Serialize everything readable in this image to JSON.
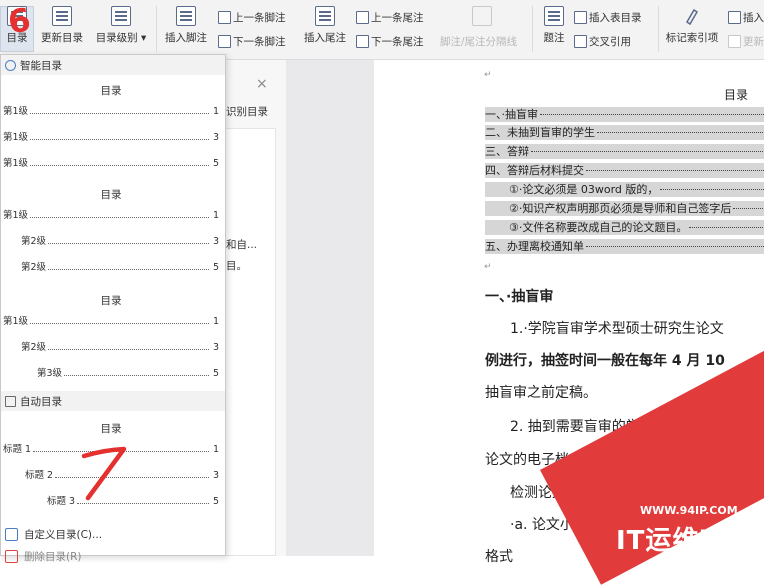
{
  "ribbon": {
    "toc_label": "目录",
    "update_toc": "更新目录",
    "toc_level": "目录级别",
    "insert_footnote": "插入脚注",
    "prev_footnote": "上一条脚注",
    "next_footnote": "下一条脚注",
    "insert_endnote": "插入尾注",
    "prev_endnote": "上一条尾注",
    "next_endnote": "下一条尾注",
    "footnote_separator": "脚注/尾注分隔线",
    "caption": "题注",
    "insert_table_toc": "插入表目录",
    "cross_ref": "交叉引用",
    "mark_index": "标记索引项",
    "insert_index": "插入",
    "update_index": "更新"
  },
  "menu": {
    "smart_toc_header": "智能目录",
    "templates": [
      {
        "title": "目录",
        "lines": [
          {
            "label": "第1级",
            "page": "1"
          },
          {
            "label": "第1级",
            "page": "3"
          },
          {
            "label": "第1级",
            "page": "5"
          }
        ]
      },
      {
        "title": "目录",
        "lines": [
          {
            "label": "第1级",
            "page": "1"
          },
          {
            "label": "第2级",
            "page": "3"
          },
          {
            "label": "第2级",
            "page": "5"
          }
        ]
      },
      {
        "title": "目录",
        "lines": [
          {
            "label": "第1级",
            "page": "1"
          },
          {
            "label": "第2级",
            "page": "3"
          },
          {
            "label": "第3级",
            "page": "5"
          }
        ]
      }
    ],
    "auto_toc_header": "自动目录",
    "auto_template": {
      "title": "目录",
      "lines": [
        {
          "label": "标题 1",
          "page": "1"
        },
        {
          "label": "标题 2",
          "page": "3"
        },
        {
          "label": "标题 3",
          "page": "5"
        }
      ]
    },
    "custom_toc": "自定义目录(C)...",
    "delete_toc": "删除目录(R)"
  },
  "pane": {
    "close": "×",
    "title": "识别目录",
    "text1": "和自...",
    "text2": "目。"
  },
  "document": {
    "para_mark": "↵",
    "toc_title": "目录",
    "toc_entries": [
      "一、·抽盲审",
      "二、未抽到盲审的学生",
      "三、答辩",
      "四、答辩后材料提交",
      "①·论文必须是 03word 版的，",
      "②·知识产权声明那页必须是导师和自己签字后",
      "③·文件名称要改成自己的论文题目。",
      "五、办理离校通知单"
    ],
    "heading1": "一、·抽盲审",
    "p1": "1.·学院盲审学术型硕士研究生论文",
    "p2a": "例进行，抽签时间一般在",
    "p2b": "每年 4 月 10",
    "p3": "抽盲审之前定稿。",
    "p4": "2. 抽到需要盲审的学生给以 3 天左",
    "p5": "论文的电子档交到王老师处进行",
    "p6": "检测论文电子档交要",
    "p7": "·a. 论文小于",
    "p8": "格式"
  },
  "annotations": {
    "six": "6",
    "seven": "7"
  },
  "watermark": {
    "site": "WWW.94IP.COM",
    "name": "IT运维空间"
  }
}
